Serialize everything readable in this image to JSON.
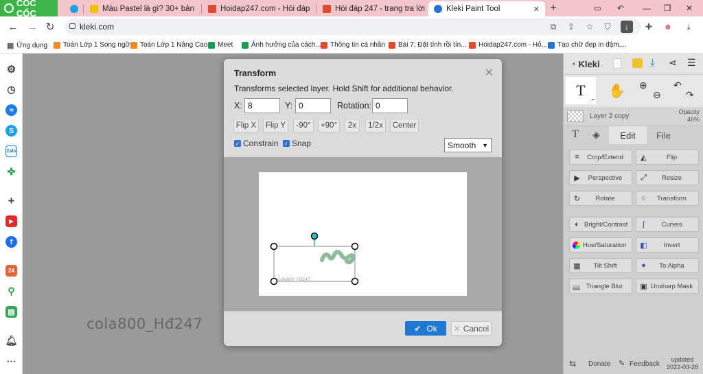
{
  "browser": {
    "brand": "CỐC CỐC",
    "tabs": [
      {
        "label": "",
        "favicon_color": "#1ea0e8"
      },
      {
        "label": "Màu Pastel là gì? 30+ bản",
        "favicon_color": "#f2c200"
      },
      {
        "label": "Hoidap247.com - Hỏi đáp",
        "favicon_color": "#e04b2e"
      },
      {
        "label": "Hỏi đáp 247 - trang tra lời",
        "favicon_color": "#e04b2e"
      },
      {
        "label": "Kleki Paint Tool",
        "favicon_color": "#2a72d0"
      }
    ],
    "url": "kleki.com",
    "bookmarks": [
      {
        "label": "Ứng dụng"
      },
      {
        "label": "Toán Lớp 1 Song ngữ"
      },
      {
        "label": "Toán Lớp 1 Nâng Cao"
      },
      {
        "label": "Meet"
      },
      {
        "label": "Ảnh hưởng của cách..."
      },
      {
        "label": "Thông tin cá nhân"
      },
      {
        "label": "Bài 7: Đặt tính rồi tín..."
      },
      {
        "label": "Hoidap247.com - Hỏ..."
      },
      {
        "label": "Tạo chữ đẹp in đậm,..."
      }
    ]
  },
  "canvas": {
    "watermark": "cola800_Hđ247"
  },
  "dialog": {
    "title": "Transform",
    "description": "Transforms selected layer. Hold Shift for additional behavior.",
    "x_label": "X:",
    "x_value": "8",
    "y_label": "Y:",
    "y_value": "0",
    "rotation_label": "Rotation:",
    "rotation_value": "0",
    "buttons": [
      "Flip X",
      "Flip Y",
      "-90°",
      "+90°",
      "2x",
      "1/2x",
      "Center"
    ],
    "constrain_label": "Constrain",
    "snap_label": "Snap",
    "interpolation": "Smooth",
    "preview_watermark": "cola800_Hđ247",
    "ok_label": "Ok",
    "cancel_label": "Cancel"
  },
  "right_panel": {
    "brand": "Kleki",
    "layer_name": "Layer 2 copy",
    "opacity_label": "Opacity",
    "opacity_value": "46%",
    "tab_edit": "Edit",
    "tab_file": "File",
    "tools": [
      {
        "label": "Crop/Extend",
        "icon": "crop-icon"
      },
      {
        "label": "Flip",
        "icon": "flip-icon"
      },
      {
        "label": "Perspective",
        "icon": "perspective-icon"
      },
      {
        "label": "Resize",
        "icon": "resize-icon"
      },
      {
        "label": "Rotate",
        "icon": "rotate-icon"
      },
      {
        "label": "Transform",
        "icon": "transform-icon"
      },
      {
        "label": "Bright/Contrast",
        "icon": "brightness-icon"
      },
      {
        "label": "Curves",
        "icon": "curves-icon"
      },
      {
        "label": "Hue/Saturation",
        "icon": "hue-icon"
      },
      {
        "label": "Invert",
        "icon": "invert-icon"
      },
      {
        "label": "Tilt Shift",
        "icon": "tilt-shift-icon"
      },
      {
        "label": "To Alpha",
        "icon": "to-alpha-icon"
      },
      {
        "label": "Triangle Blur",
        "icon": "triangle-blur-icon"
      },
      {
        "label": "Unsharp Mask",
        "icon": "unsharp-mask-icon"
      }
    ],
    "donate_label": "Donate",
    "feedback_label": "Feedback",
    "updated_label": "updated",
    "updated_date": "2022-03-28"
  },
  "colors": {
    "accent": "#1f78d1",
    "titlebar": "#f3c6cc",
    "cococ_green": "#3cb449"
  }
}
